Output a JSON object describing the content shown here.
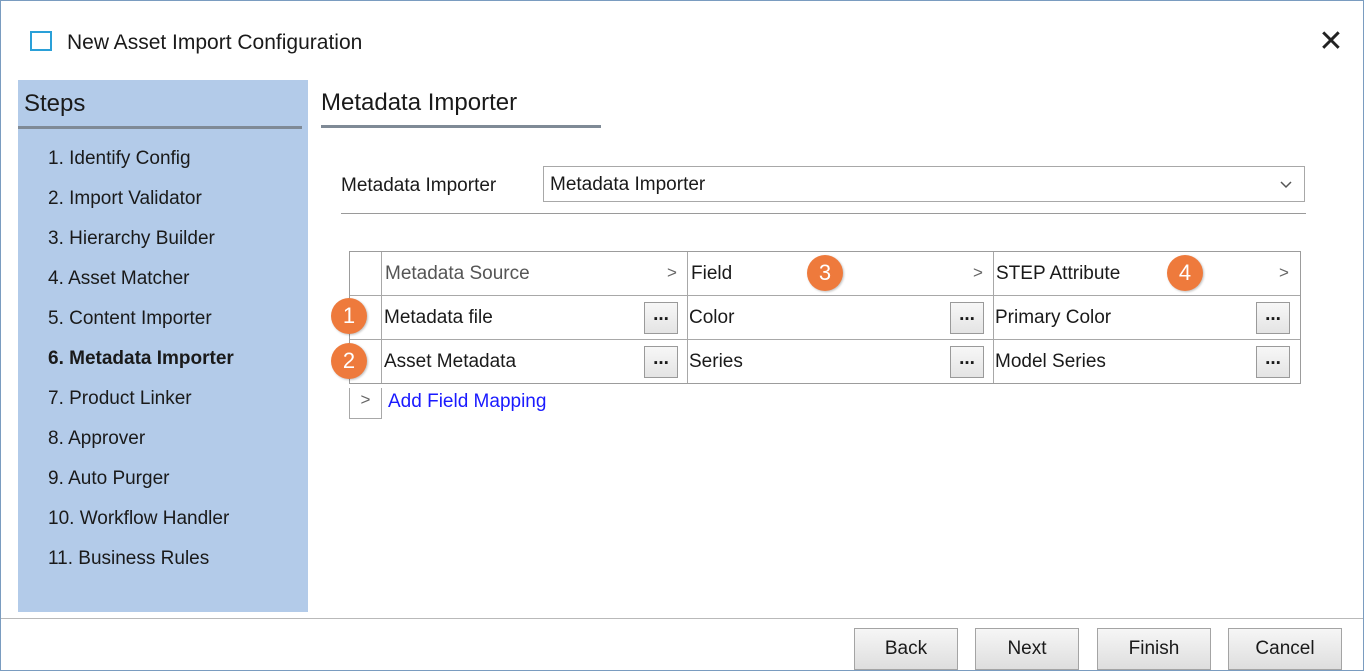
{
  "window": {
    "title": "New Asset Import Configuration",
    "close_glyph": "✕",
    "title_icon": "window-icon"
  },
  "sidebar": {
    "title": "Steps",
    "items": [
      {
        "label": "1. Identify Config"
      },
      {
        "label": "2. Import Validator"
      },
      {
        "label": "3. Hierarchy Builder"
      },
      {
        "label": "4. Asset Matcher"
      },
      {
        "label": "5. Content Importer"
      },
      {
        "label": "6. Metadata Importer",
        "active": true
      },
      {
        "label": "7. Product Linker"
      },
      {
        "label": "8. Approver"
      },
      {
        "label": "9. Auto Purger"
      },
      {
        "label": "10. Workflow Handler"
      },
      {
        "label": "11. Business Rules"
      }
    ],
    "background_color": "#b3cbe9"
  },
  "main": {
    "title": "Metadata Importer",
    "importer": {
      "label": "Metadata Importer",
      "value": "Metadata Importer"
    },
    "table": {
      "columns": [
        {
          "label": "Metadata Source",
          "sort_glyph": ">"
        },
        {
          "label": "Field",
          "sort_glyph": ">"
        },
        {
          "label": "STEP Attribute",
          "sort_glyph": ">"
        }
      ],
      "rows": [
        {
          "source": "Metadata file",
          "field": "Color",
          "attribute": "Primary Color"
        },
        {
          "source": "Asset Metadata",
          "field": "Series",
          "attribute": "Model Series"
        }
      ],
      "browse_label": "...",
      "add_row_glyph": ">",
      "add_link": "Add Field Mapping"
    },
    "callouts": [
      "1",
      "2",
      "3",
      "4"
    ],
    "callout_color": "#ee7a3c"
  },
  "footer": {
    "back": "Back",
    "next": "Next",
    "finish": "Finish",
    "cancel": "Cancel"
  }
}
